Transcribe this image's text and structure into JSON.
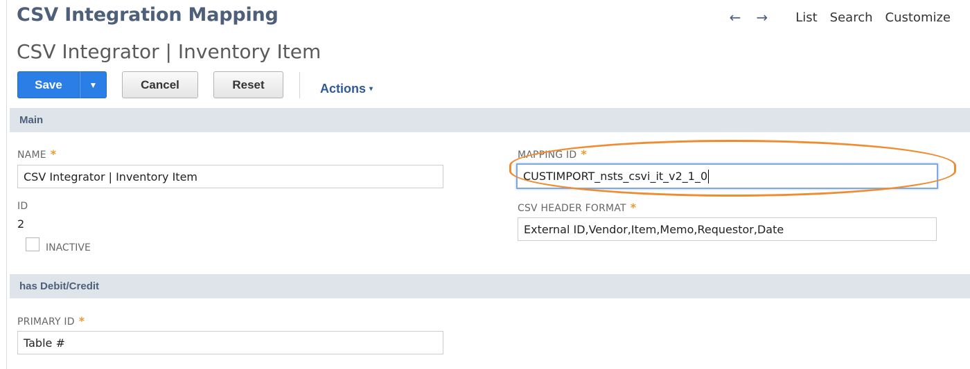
{
  "header": {
    "page_title": "CSV Integration Mapping",
    "record_title": "CSV Integrator | Inventory Item",
    "nav": {
      "back_icon": "left-arrow",
      "forward_icon": "right-arrow",
      "back_glyph": "←",
      "forward_glyph": "→",
      "list_label": "List",
      "search_label": "Search",
      "customize_label": "Customize"
    }
  },
  "toolbar": {
    "save_label": "Save",
    "save_menu_glyph": "▼",
    "cancel_label": "Cancel",
    "reset_label": "Reset",
    "actions_label": "Actions",
    "actions_caret": "▾"
  },
  "sections": {
    "main": "Main",
    "debit_credit": "has Debit/Credit"
  },
  "fields": {
    "name": {
      "label": "NAME",
      "required_mark": "*",
      "value": "CSV Integrator | Inventory Item"
    },
    "id": {
      "label": "ID",
      "value": "2"
    },
    "inactive": {
      "label": "INACTIVE",
      "checked": false
    },
    "mapping_id": {
      "label": "MAPPING ID",
      "required_mark": "*",
      "value": "CUSTIMPORT_nsts_csvi_it_v2_1_0",
      "focused": true
    },
    "csv_header_format": {
      "label": "CSV HEADER FORMAT",
      "required_mark": "*",
      "value": "External ID,Vendor,Item,Memo,Requestor,Date"
    },
    "primary_id": {
      "label": "PRIMARY ID",
      "required_mark": "*",
      "value": "Table #"
    }
  },
  "colors": {
    "title": "#4d5f79",
    "primary_button": "#2a7ee6",
    "section_bar": "#dfe4eb",
    "required": "#e89a2d",
    "annotation_ring": "#f08b2f",
    "link": "#2e5a9a"
  }
}
